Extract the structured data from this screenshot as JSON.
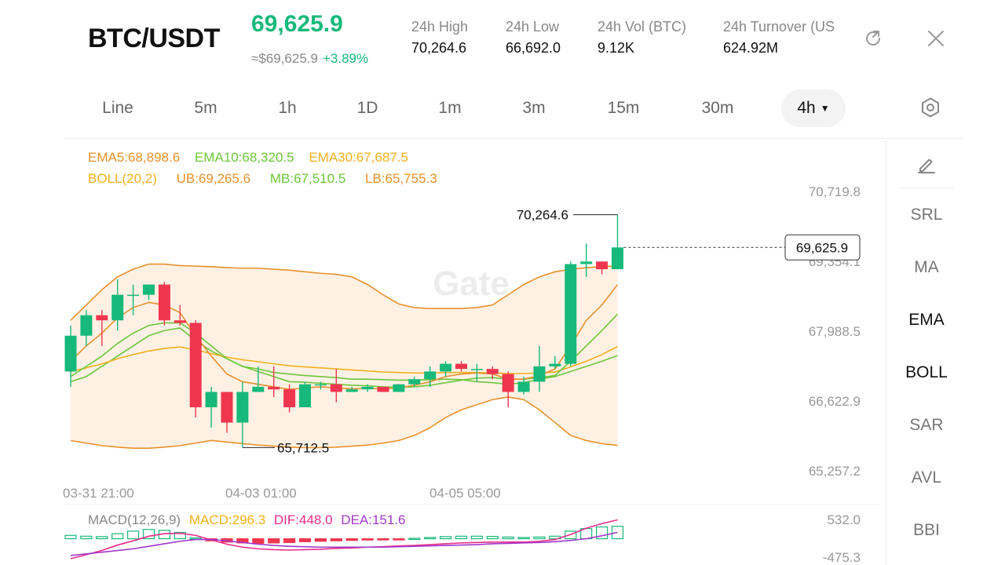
{
  "header": {
    "pair": "BTC/USDT",
    "last_price": "69,625.9",
    "fiat_price": "≈$69,625.9",
    "change": "+3.89%",
    "stats": [
      {
        "label": "24h   High",
        "value": "70,264.6"
      },
      {
        "label": "24h   Low",
        "value": "66,692.0"
      },
      {
        "label": "24h   Vol (BTC)",
        "value": "9.12K"
      },
      {
        "label": "24h   Turnover (US",
        "value": "624.92M"
      }
    ],
    "icons": [
      "refresh-icon",
      "close-icon"
    ]
  },
  "timeframes": {
    "items": [
      "Line",
      "5m",
      "1h",
      "1D",
      "1m",
      "3m",
      "15m",
      "30m"
    ],
    "active": "4h",
    "active_caret": "▼"
  },
  "indicators": {
    "ema5": "EMA5:68,898.6",
    "ema10": "EMA10:68,320.5",
    "ema30": "EMA30:67,687.5",
    "boll": "BOLL(20,2)",
    "ub": "UB:69,265.6",
    "mb": "MB:67,510.5",
    "lb": "LB:65,755.3",
    "macd_title": "MACD(12,26,9)",
    "macd": "MACD:296.3",
    "dif": "DIF:448.0",
    "dea": "DEA:151.6"
  },
  "price_axis": {
    "labels": [
      "70,719.8",
      "69,354.1",
      "67,988.5",
      "66,622.9",
      "65,257.2"
    ],
    "current_price_label": "69,625.9",
    "high_marker": "70,264.6",
    "low_marker": "65,712.5"
  },
  "time_axis": {
    "labels": [
      "03-31 21:00",
      "04-03 01:00",
      "04-05 05:00"
    ]
  },
  "macd_axis": {
    "labels": [
      "532.0",
      "-475.3"
    ]
  },
  "watermark": "Gate",
  "sidebar": {
    "items": [
      "SRL",
      "MA",
      "EMA",
      "BOLL",
      "SAR",
      "AVL",
      "BBI"
    ],
    "active": [
      "EMA",
      "BOLL"
    ]
  },
  "colors": {
    "up": "#16b979",
    "down": "#f0364f",
    "ema5": "#e8912c",
    "ema10": "#6cc63a",
    "ema30": "#f2b01e",
    "boll_ub": "#e8912c",
    "boll_mb": "#6cc63a",
    "boll_lb": "#e8912c",
    "macd_label": "#f2b01e",
    "dif": "#ea2c8a",
    "dea": "#a238c9"
  },
  "chart_data": {
    "type": "candlestick",
    "timeframe": "4h",
    "y_range": [
      65257.2,
      70719.8
    ],
    "x_labels": [
      "03-31 21:00",
      "04-03 01:00",
      "04-05 05:00"
    ],
    "candles": [
      {
        "o": 67200,
        "h": 68100,
        "l": 66900,
        "c": 67900
      },
      {
        "o": 67900,
        "h": 68400,
        "l": 67700,
        "c": 68300
      },
      {
        "o": 68300,
        "h": 68400,
        "l": 67700,
        "c": 68200
      },
      {
        "o": 68200,
        "h": 69000,
        "l": 68000,
        "c": 68700
      },
      {
        "o": 68700,
        "h": 68900,
        "l": 68300,
        "c": 68700
      },
      {
        "o": 68700,
        "h": 68900,
        "l": 68600,
        "c": 68900
      },
      {
        "o": 68900,
        "h": 68950,
        "l": 68100,
        "c": 68200
      },
      {
        "o": 68200,
        "h": 68500,
        "l": 68100,
        "c": 68150
      },
      {
        "o": 68150,
        "h": 68200,
        "l": 66300,
        "c": 66500
      },
      {
        "o": 66500,
        "h": 66900,
        "l": 66100,
        "c": 66800
      },
      {
        "o": 66800,
        "h": 66800,
        "l": 66000,
        "c": 66200
      },
      {
        "o": 66200,
        "h": 67000,
        "l": 65712.5,
        "c": 66800
      },
      {
        "o": 66800,
        "h": 67300,
        "l": 66800,
        "c": 66900
      },
      {
        "o": 66900,
        "h": 67300,
        "l": 66700,
        "c": 66850
      },
      {
        "o": 66850,
        "h": 66950,
        "l": 66400,
        "c": 66500
      },
      {
        "o": 66500,
        "h": 67000,
        "l": 66500,
        "c": 66950
      },
      {
        "o": 66950,
        "h": 67000,
        "l": 66850,
        "c": 66950
      },
      {
        "o": 66950,
        "h": 67250,
        "l": 66600,
        "c": 66800
      },
      {
        "o": 66800,
        "h": 66900,
        "l": 66800,
        "c": 66850
      },
      {
        "o": 66850,
        "h": 66950,
        "l": 66800,
        "c": 66900
      },
      {
        "o": 66900,
        "h": 66900,
        "l": 66800,
        "c": 66800
      },
      {
        "o": 66800,
        "h": 66950,
        "l": 66800,
        "c": 66950
      },
      {
        "o": 66950,
        "h": 67100,
        "l": 66900,
        "c": 67050
      },
      {
        "o": 67050,
        "h": 67300,
        "l": 66900,
        "c": 67200
      },
      {
        "o": 67200,
        "h": 67400,
        "l": 67100,
        "c": 67350
      },
      {
        "o": 67350,
        "h": 67400,
        "l": 67200,
        "c": 67250
      },
      {
        "o": 67250,
        "h": 67350,
        "l": 67000,
        "c": 67250
      },
      {
        "o": 67250,
        "h": 67300,
        "l": 67050,
        "c": 67150
      },
      {
        "o": 67150,
        "h": 67200,
        "l": 66500,
        "c": 66800
      },
      {
        "o": 66800,
        "h": 67100,
        "l": 66750,
        "c": 67000
      },
      {
        "o": 67000,
        "h": 67700,
        "l": 66800,
        "c": 67300
      },
      {
        "o": 67300,
        "h": 67500,
        "l": 67250,
        "c": 67350
      },
      {
        "o": 67350,
        "h": 69350,
        "l": 67300,
        "c": 69300
      },
      {
        "o": 69300,
        "h": 69700,
        "l": 69050,
        "c": 69350
      },
      {
        "o": 69350,
        "h": 69350,
        "l": 69100,
        "c": 69200
      },
      {
        "o": 69200,
        "h": 70264.6,
        "l": 69200,
        "c": 69625.9
      }
    ],
    "boll_ub": [
      68200,
      68500,
      68800,
      69050,
      69200,
      69300,
      69300,
      69270,
      69260,
      69250,
      69230,
      69220,
      69220,
      69200,
      69180,
      69150,
      69120,
      69100,
      69050,
      68900,
      68700,
      68520,
      68450,
      68430,
      68430,
      68430,
      68450,
      68500,
      68700,
      68900,
      69050,
      69150,
      69200,
      69230,
      69250,
      69265.6
    ],
    "boll_mb": [
      67000,
      67100,
      67300,
      67500,
      67700,
      67900,
      68000,
      68050,
      67800,
      67600,
      67450,
      67300,
      67250,
      67180,
      67150,
      67120,
      67100,
      67080,
      67050,
      67050,
      67040,
      67030,
      67030,
      67040,
      67050,
      67040,
      67000,
      66980,
      66950,
      66980,
      67050,
      67100,
      67200,
      67300,
      67400,
      67510.5
    ],
    "boll_lb": [
      65850,
      65800,
      65750,
      65720,
      65700,
      65700,
      65720,
      65750,
      65800,
      65850,
      65820,
      65790,
      65760,
      65740,
      65720,
      65710,
      65710,
      65720,
      65740,
      65760,
      65800,
      65850,
      65950,
      66100,
      66300,
      66450,
      66550,
      66650,
      66700,
      66650,
      66450,
      66200,
      65950,
      65850,
      65790,
      65755.3
    ],
    "ema5": [
      67400,
      67700,
      67950,
      68250,
      68450,
      68550,
      68500,
      68350,
      67900,
      67500,
      67150,
      67000,
      66950,
      66900,
      66850,
      66880,
      66900,
      66880,
      66860,
      66870,
      66860,
      66880,
      66930,
      67000,
      67100,
      67150,
      67170,
      67150,
      67050,
      67050,
      67120,
      67250,
      67700,
      68200,
      68500,
      68898.6
    ],
    "ema10": [
      67100,
      67300,
      67500,
      67750,
      67950,
      68100,
      68150,
      68150,
      67950,
      67700,
      67450,
      67300,
      67200,
      67100,
      67000,
      66990,
      66970,
      66950,
      66930,
      66920,
      66900,
      66890,
      66900,
      66930,
      66980,
      67030,
      67070,
      67080,
      67050,
      67050,
      67080,
      67120,
      67400,
      67700,
      68000,
      68320.5
    ],
    "ema30": [
      67200,
      67270,
      67350,
      67450,
      67530,
      67600,
      67650,
      67680,
      67620,
      67550,
      67480,
      67430,
      67390,
      67350,
      67310,
      67290,
      67270,
      67250,
      67230,
      67210,
      67190,
      67180,
      67170,
      67170,
      67180,
      67180,
      67180,
      67170,
      67160,
      67160,
      67170,
      67190,
      67290,
      67400,
      67530,
      67687.5
    ],
    "macd_hist": [
      80,
      60,
      50,
      120,
      180,
      220,
      200,
      150,
      20,
      -50,
      -80,
      -100,
      -110,
      -100,
      -90,
      -70,
      -60,
      -50,
      -40,
      -30,
      -20,
      -10,
      10,
      30,
      50,
      60,
      60,
      55,
      40,
      30,
      40,
      60,
      180,
      240,
      280,
      296.3
    ],
    "dif": [
      -475.3,
      -380,
      -280,
      -150,
      -50,
      60,
      120,
      130,
      80,
      -30,
      -130,
      -200,
      -240,
      -260,
      -270,
      -260,
      -250,
      -230,
      -220,
      -200,
      -190,
      -170,
      -160,
      -140,
      -120,
      -100,
      -90,
      -80,
      -80,
      -80,
      -60,
      -20,
      100,
      250,
      360,
      448.0
    ],
    "dea": [
      -400,
      -360,
      -320,
      -280,
      -240,
      -180,
      -120,
      -60,
      -20,
      -20,
      -50,
      -90,
      -130,
      -160,
      -180,
      -190,
      -200,
      -200,
      -200,
      -200,
      -200,
      -190,
      -180,
      -170,
      -160,
      -150,
      -140,
      -120,
      -110,
      -100,
      -90,
      -70,
      -40,
      0,
      70,
      151.6
    ],
    "macd_range": [
      -475.3,
      532.0
    ]
  }
}
